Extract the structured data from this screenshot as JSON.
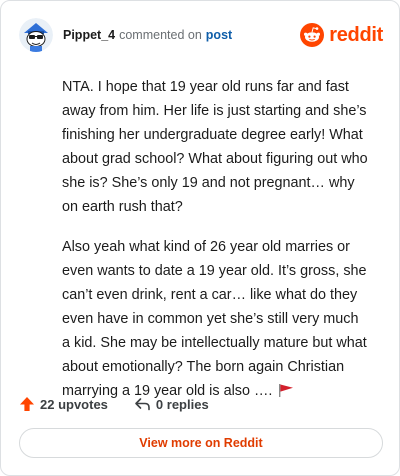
{
  "header": {
    "username": "Pippet_4",
    "action_text": "commented on",
    "post_link": "post",
    "brand": "reddit"
  },
  "comment": {
    "paragraphs": [
      "NTA. I hope that 19 year old runs far and fast away from him. Her life is just starting and she’s finishing her undergraduate degree early! What about grad school? What about figuring out who she is? She’s only 19 and not pregnant… why on earth rush that?",
      "Also yeah what kind of 26 year old marries or even wants to date a 19 year old. It’s gross, she can’t even drink, rent a car… like what do they even have in common yet she’s still very much a kid. She may be intellectually mature but what about emotionally? The born again Christian marrying a 19 year old is also …."
    ]
  },
  "footer": {
    "upvotes": "22 upvotes",
    "replies": "0 replies",
    "view_more": "View more on Reddit"
  },
  "colors": {
    "brand": "#ff4500",
    "link": "#0f5ea9",
    "view_more": "#e03c00"
  },
  "icons": {
    "avatar": "snoo-avatar",
    "logo": "reddit-logo-icon",
    "upvote": "upvote-arrow-icon",
    "reply": "reply-arrow-icon",
    "flag": "red-flag-emoji"
  }
}
